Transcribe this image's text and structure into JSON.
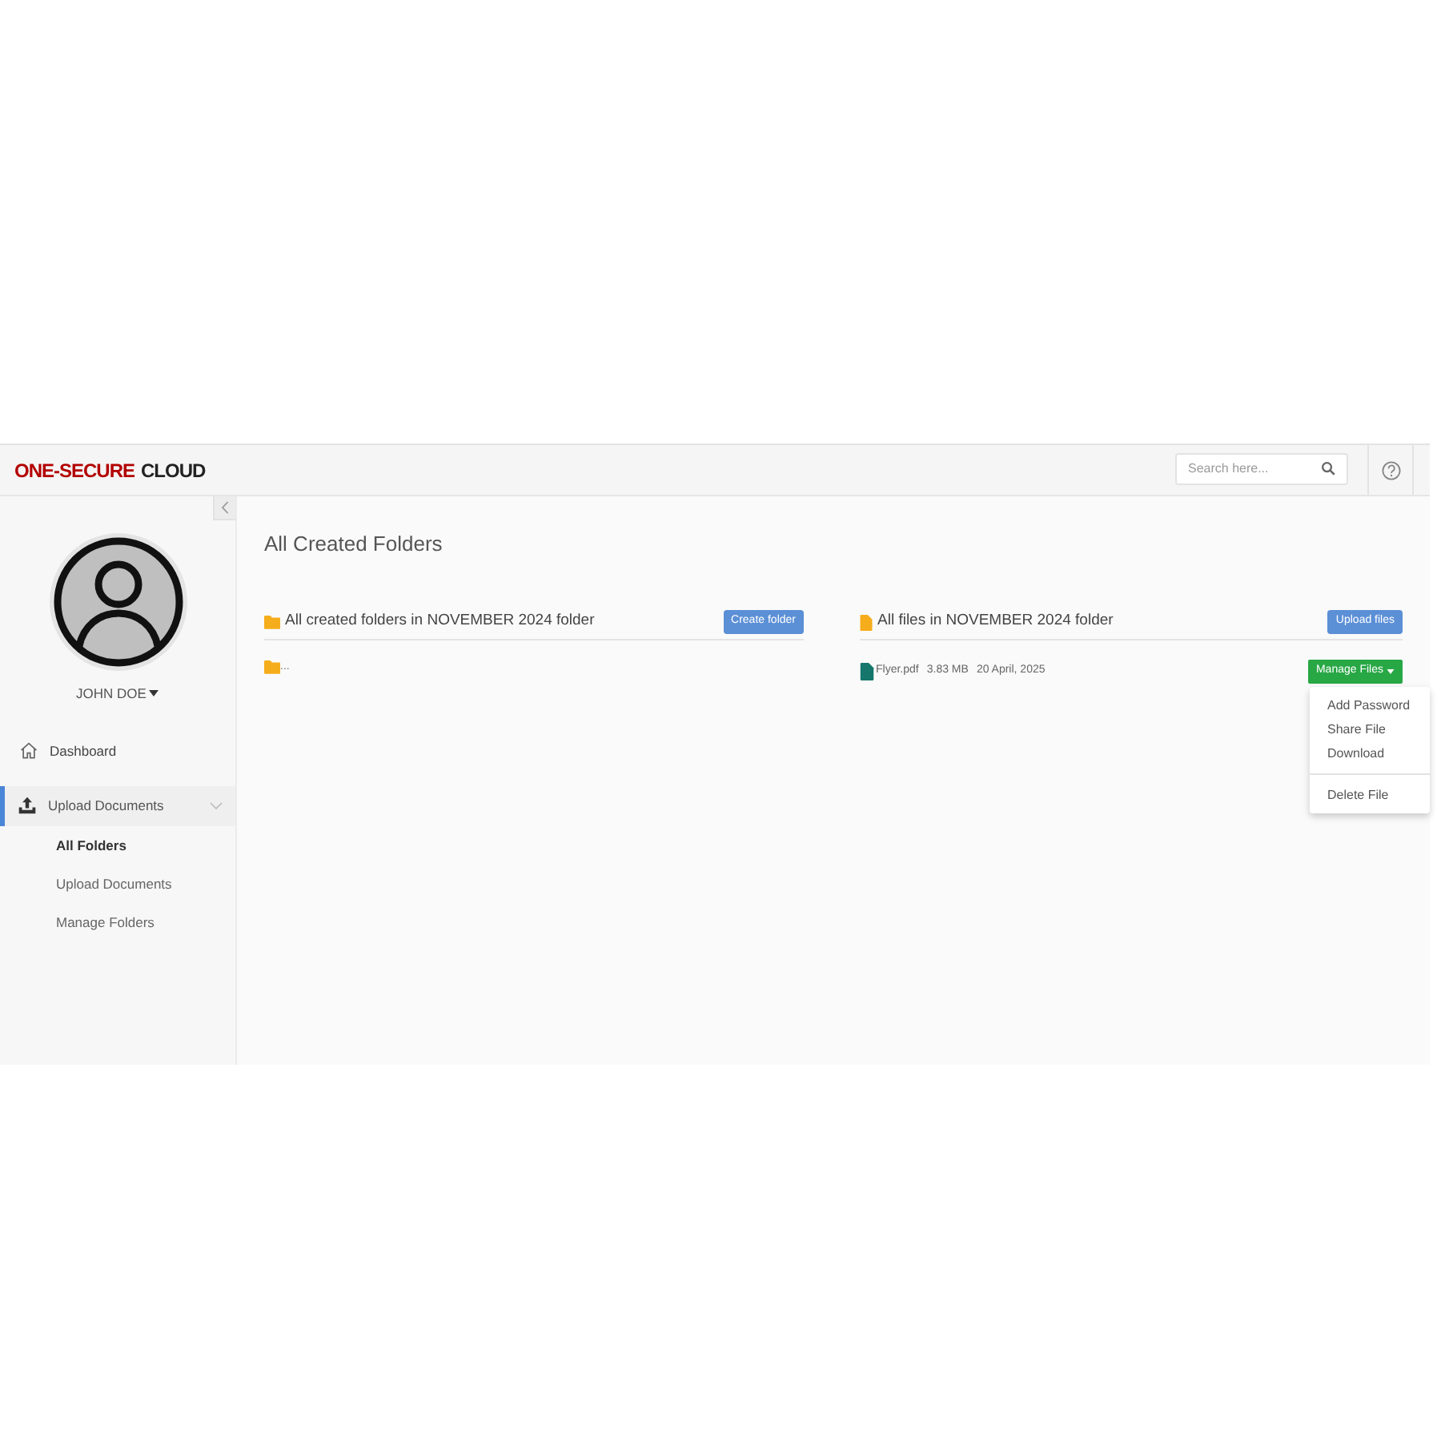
{
  "header": {
    "logo": {
      "primary": "ONE-SECURE",
      "secondary": "CLOUD"
    },
    "search": {
      "placeholder": "Search here..."
    }
  },
  "sidebar": {
    "user": {
      "name": "JOHN DOE"
    },
    "items": [
      {
        "kind": "link",
        "label": "Dashboard",
        "selected": false
      },
      {
        "kind": "group",
        "label": "Upload Documents",
        "selected": true,
        "expanded": true,
        "children": [
          {
            "label": "All Folders",
            "selected": true
          },
          {
            "label": "Upload Documents",
            "selected": false
          },
          {
            "label": "Manage Folders",
            "selected": false
          }
        ]
      }
    ]
  },
  "main": {
    "title": "All Created Folders",
    "folders_panel": {
      "heading": "All created folders in NOVEMBER 2024 folder",
      "button": "Create folder",
      "folders": [
        {
          "name": "..."
        }
      ]
    },
    "files_panel": {
      "heading": "All files in NOVEMBER 2024 folder",
      "button": "Upload files",
      "files": [
        {
          "name": "Flyer.pdf",
          "size": "3.83 MB",
          "date": "20 April, 2025",
          "menu_button": "Manage Files",
          "menu": {
            "open": true,
            "sections": [
              {
                "items": [
                  "Add Password",
                  "Share File",
                  "Download"
                ]
              },
              {
                "items": [
                  "Delete File"
                ]
              }
            ]
          }
        }
      ]
    }
  }
}
